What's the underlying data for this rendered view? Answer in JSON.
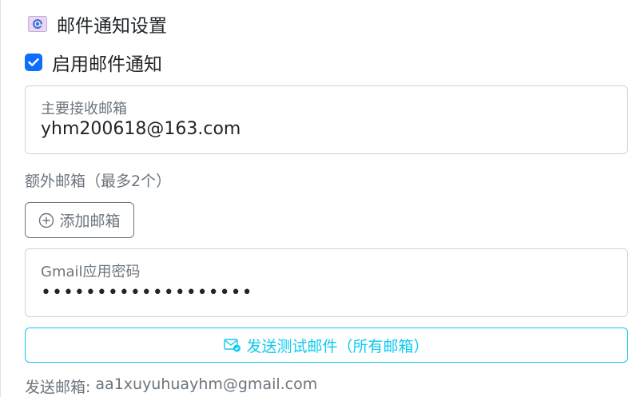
{
  "settings": {
    "title": "邮件通知设置",
    "title_icon": "email-envelope-icon",
    "enable_label": "启用邮件通知",
    "enable_checked": true,
    "primary": {
      "label": "主要接收邮箱",
      "value": "yhm200618@163.com"
    },
    "extra_label": "额外邮箱（最多2个）",
    "add_button": "添加邮箱",
    "password": {
      "label": "Gmail应用密码",
      "value": "•••••••••••••••••••"
    },
    "test_button": "发送测试邮件（所有邮箱）",
    "sender_label": "发送邮箱:",
    "sender_value": "aa1xuyuhuayhm@gmail.com"
  },
  "colors": {
    "primary": "#0d6efd",
    "info": "#0dcaf0",
    "muted": "#6c757d"
  }
}
